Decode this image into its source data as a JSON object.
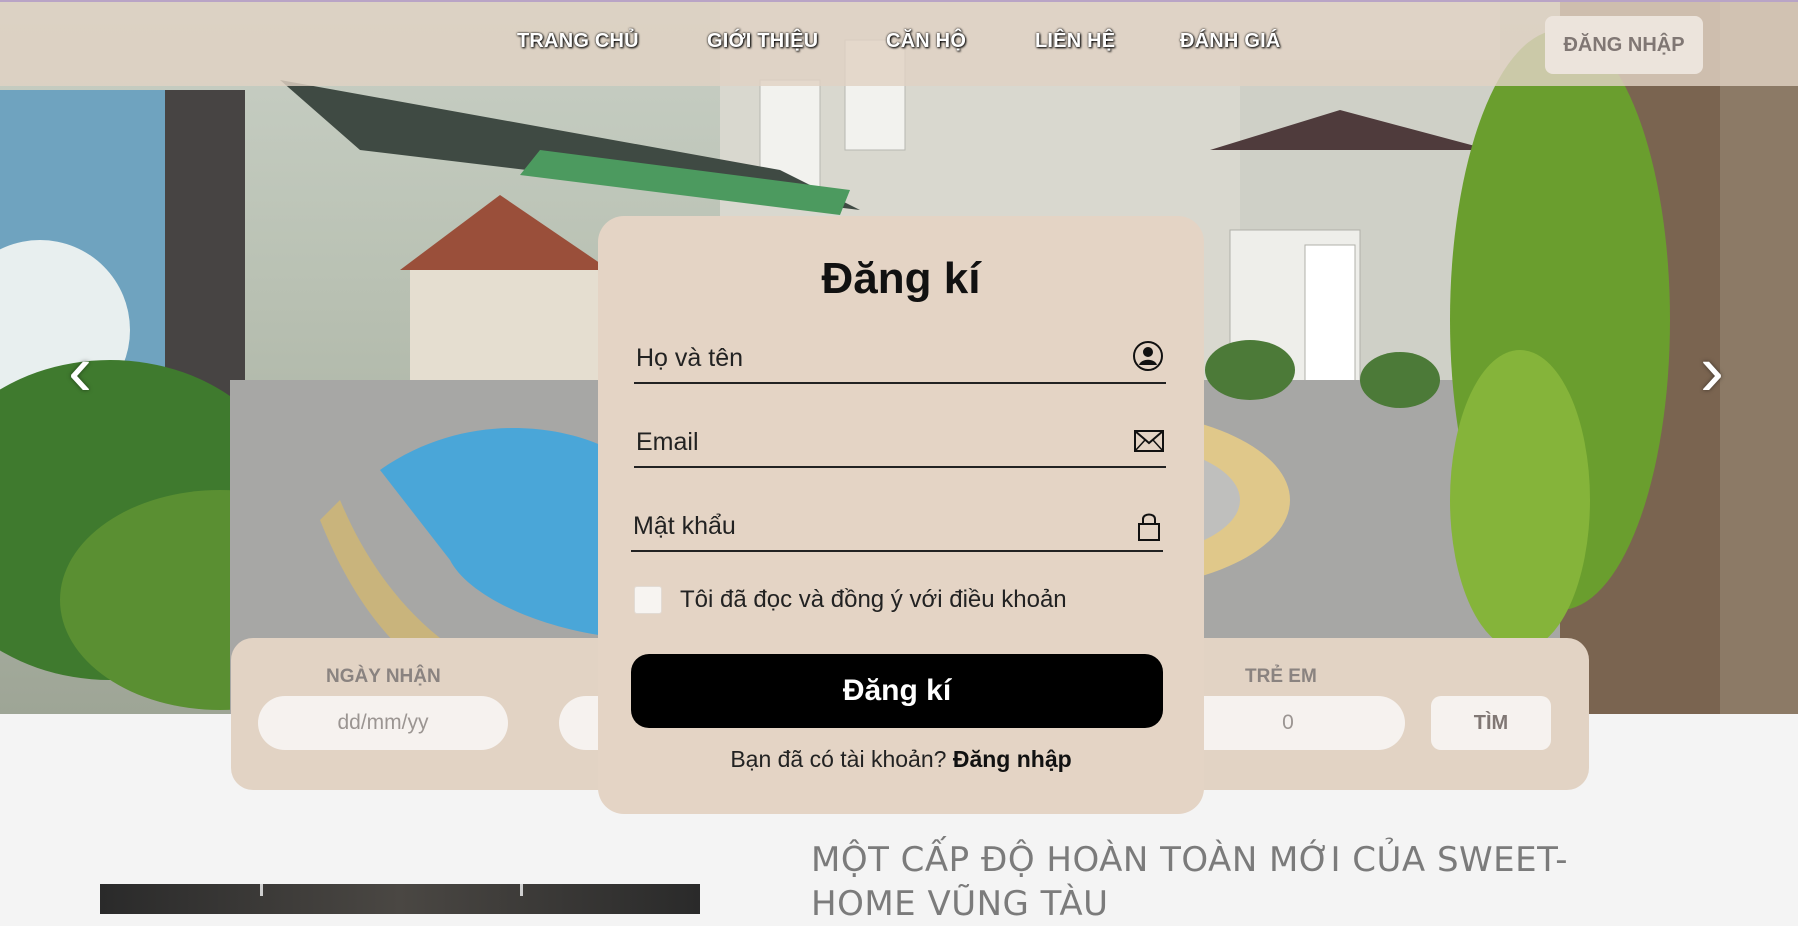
{
  "nav": {
    "items": [
      "TRANG CHỦ",
      "GIỚI THIỆU",
      "CĂN HỘ",
      "LIÊN HỆ",
      "ĐÁNH GIÁ"
    ],
    "login_label": "ĐĂNG NHẬP"
  },
  "carousel": {
    "prev_glyph": "‹",
    "next_glyph": "›"
  },
  "booking": {
    "checkin_label": "NGÀY NHẬN",
    "checkin_placeholder": "dd/mm/yy",
    "children_label": "TRẺ EM",
    "children_value": "0",
    "search_label": "TÌM"
  },
  "signup": {
    "title": "Đăng kí",
    "name_placeholder": "Họ và tên",
    "email_placeholder": "Email",
    "password_placeholder": "Mật khẩu",
    "terms_label": "Tôi đã đọc và đồng ý với điều khoản",
    "submit_label": "Đăng kí",
    "have_account_text": "Bạn đã có tài khoản?",
    "login_link": "Đăng nhập"
  },
  "content": {
    "headline": "MỘT CẤP ĐỘ HOÀN TOÀN MỚI CỦA SWEET-HOME VŨNG TÀU"
  },
  "colors": {
    "topbar": "#e1d2c3",
    "modal": "#e4d4c5",
    "submit": "#000000",
    "nav_border": "#b9a4c6"
  },
  "icons": [
    "user-icon",
    "envelope-icon",
    "lock-icon",
    "chevron-left-icon",
    "chevron-right-icon"
  ]
}
